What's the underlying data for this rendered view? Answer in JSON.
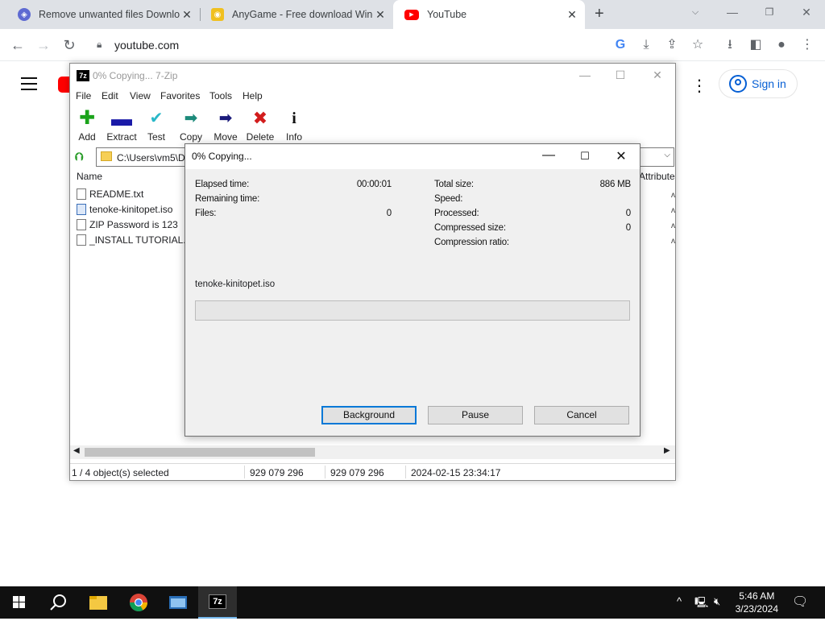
{
  "browser": {
    "tabs": [
      {
        "title": "Remove unwanted files Downloa",
        "favicon": "shield-icon",
        "color": "#5e6ad2"
      },
      {
        "title": "AnyGame - Free download Wind",
        "favicon": "anygame-icon",
        "color": "#f0c020"
      },
      {
        "title": "YouTube",
        "favicon": "youtube-icon",
        "color": "#ff0000",
        "active": true
      }
    ],
    "new_tab": "+",
    "url": "youtube.com"
  },
  "youtube": {
    "sign_in": "Sign in"
  },
  "zip_window": {
    "title": "0% Copying... 7-Zip",
    "menu": [
      "File",
      "Edit",
      "View",
      "Favorites",
      "Tools",
      "Help"
    ],
    "toolbar": [
      "Add",
      "Extract",
      "Test",
      "Copy",
      "Move",
      "Delete",
      "Info"
    ],
    "path": "C:\\Users\\vm5\\D",
    "columns": {
      "name": "Name",
      "attributes": "Attribute"
    },
    "files": [
      "README.txt",
      "tenoke-kinitopet.iso",
      "ZIP Password is 123",
      "_INSTALL TUTORIAL.txt"
    ],
    "status": {
      "selected": "1 / 4 object(s) selected",
      "size": "929 079 296",
      "packed": "929 079 296",
      "modified": "2024-02-15 23:34:17"
    }
  },
  "dialog": {
    "title": "0% Copying...",
    "left": [
      {
        "label": "Elapsed time:",
        "value": "00:00:01"
      },
      {
        "label": "Remaining time:",
        "value": ""
      },
      {
        "label": "Files:",
        "value": "0"
      }
    ],
    "right": [
      {
        "label": "Total size:",
        "value": "886 MB"
      },
      {
        "label": "Speed:",
        "value": ""
      },
      {
        "label": "Processed:",
        "value": "0"
      },
      {
        "label": "Compressed size:",
        "value": "0"
      },
      {
        "label": "Compression ratio:",
        "value": ""
      }
    ],
    "current_file": "tenoke-kinitopet.iso",
    "progress": 0,
    "buttons": {
      "background": "Background",
      "pause": "Pause",
      "cancel": "Cancel"
    }
  },
  "taskbar": {
    "time": "5:46 AM",
    "date": "3/23/2024"
  }
}
